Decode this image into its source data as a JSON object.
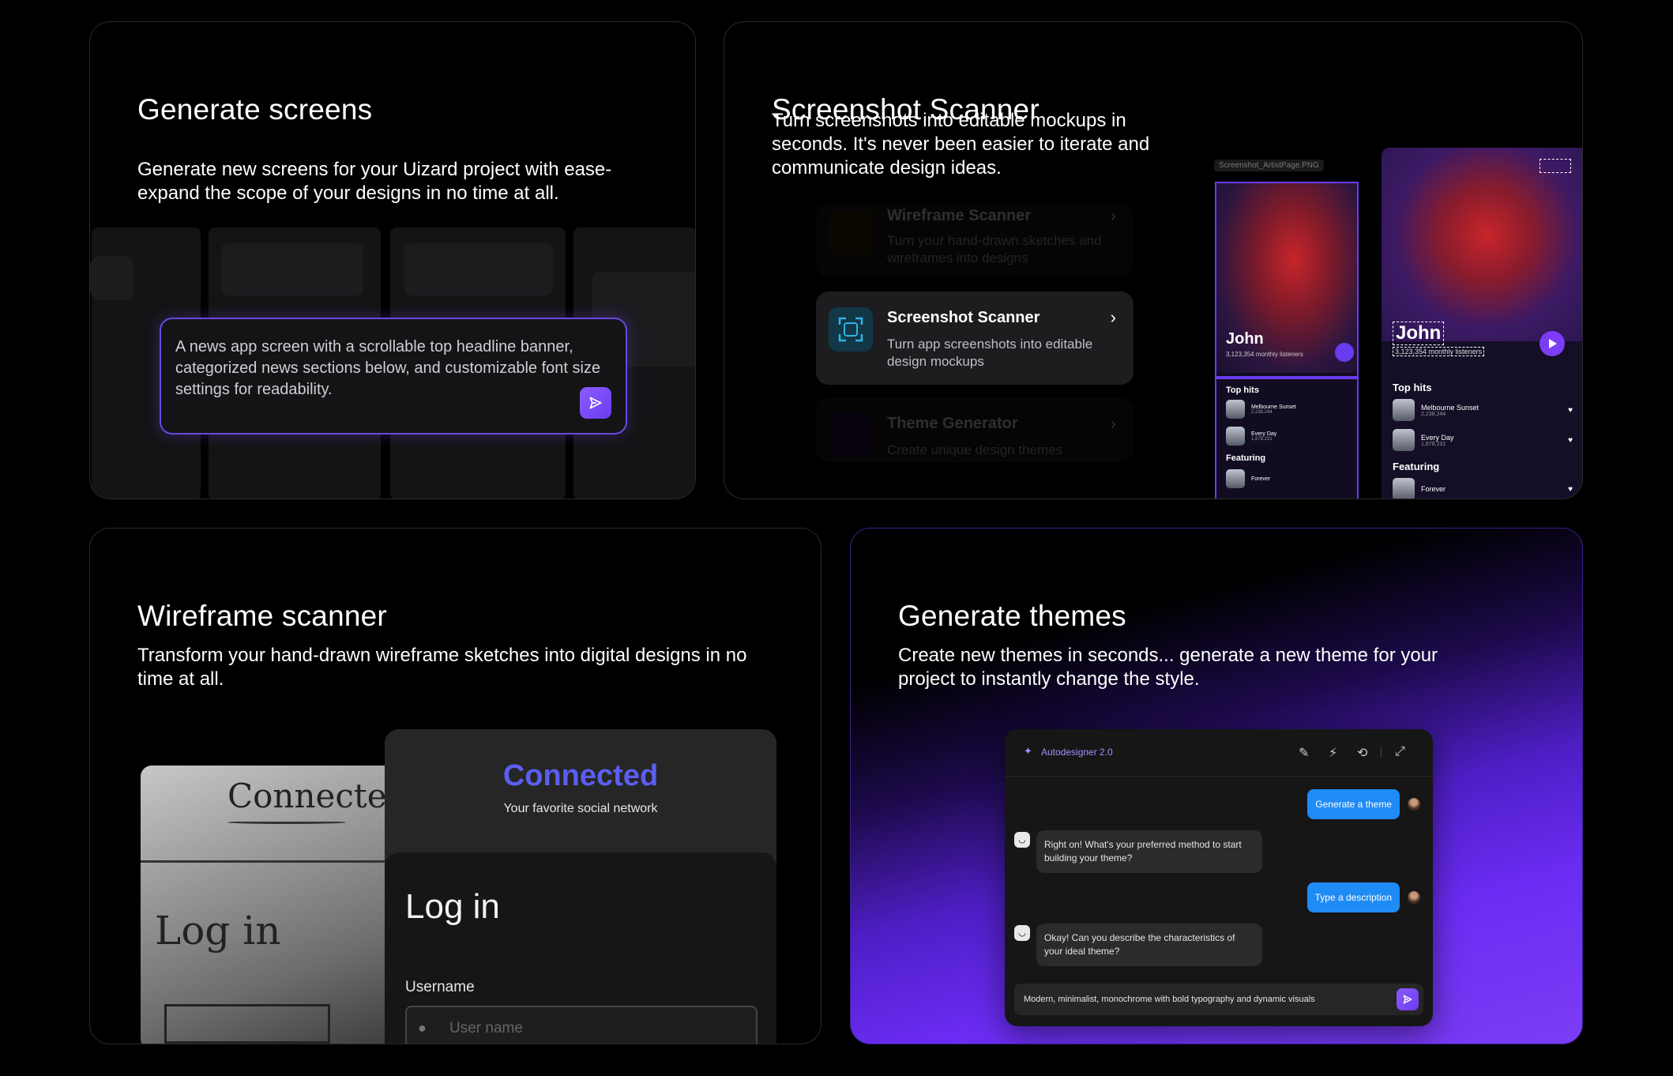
{
  "cards": {
    "generate_screens": {
      "title": "Generate screens",
      "description": "Generate new screens for your Uizard project with ease- expand the scope of your designs in no time at all.",
      "prompt_text": "A news app screen with a scrollable top headline banner, categorized news sections below, and customizable font size settings for readability.",
      "send_icon": "send-icon"
    },
    "screenshot_scanner": {
      "title": "Screenshot Scanner",
      "description": "Turn screenshots into editable mockups in seconds. It's never been easier to iterate and communicate design ideas.",
      "features": [
        {
          "title": "Wireframe Scanner",
          "subtitle": "Turn your hand-drawn sketches and wireframes into designs"
        },
        {
          "title": "Screenshot Scanner",
          "subtitle": "Turn app screenshots into editable design mockups"
        },
        {
          "title": "Theme Generator",
          "subtitle": "Create unique design themes"
        }
      ],
      "file_label": "Screenshot_ArtistPage.PNG",
      "artist_name": "John",
      "listeners": "3,123,354 monthly listeners",
      "top_hits_label": "Top hits",
      "featuring_label": "Featuring",
      "songs": [
        {
          "title": "Melbourne Sunset",
          "plays": "2,238,244"
        },
        {
          "title": "Every Day",
          "plays": "1,878,231"
        }
      ],
      "featuring_song": "Forever"
    },
    "wireframe_scanner": {
      "title": "Wireframe scanner",
      "description": "Transform your hand-drawn wireframe sketches into digital designs in no time at all.",
      "sketch_title": "Connecte",
      "sketch_login": "Log in",
      "connected_title": "Connected",
      "connected_subtitle": "Your favorite social network",
      "login_title": "Log in",
      "username_label": "Username",
      "username_placeholder": "User name"
    },
    "generate_themes": {
      "title": "Generate themes",
      "description": "Create new themes in seconds... generate a new theme for your project to instantly change the style.",
      "app_name": "Autodesigner 2.0",
      "messages": [
        {
          "from": "user",
          "text": "Generate a theme"
        },
        {
          "from": "bot",
          "text": "Right on! What's your preferred method to start building your theme?"
        },
        {
          "from": "user",
          "text": "Type a description"
        },
        {
          "from": "bot",
          "text": "Okay! Can you describe the characteristics of your ideal theme?"
        }
      ],
      "input_value": "Modern, minimalist, monochrome with bold typography and dynamic visuals"
    }
  },
  "colors": {
    "accent_purple": "#7b3df5",
    "chat_blue": "#1f8bf5",
    "connected_blue": "#5b5ef0"
  }
}
